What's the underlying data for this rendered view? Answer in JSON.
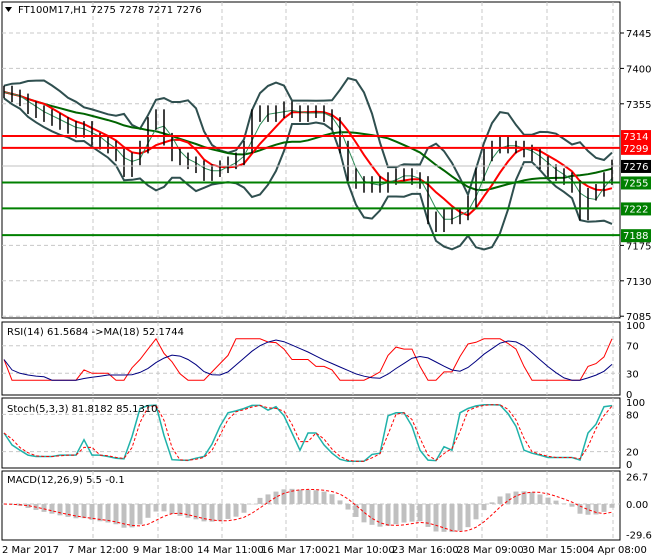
{
  "header": {
    "symbol": "FT100M17,H1",
    "ohlc": "7275 7278 7271 7276"
  },
  "colors": {
    "resistance": "#ff0000",
    "support": "#008000",
    "bid": "#000000",
    "band": "#2f4f4f",
    "ma_fast": "#ff0000",
    "ma_slow": "#006400",
    "rsi": "#ff0000",
    "rsi_ma": "#000080",
    "stoch_main": "#20b2aa",
    "stoch_signal": "#ff0000",
    "macd_hist": "#c0c0c0"
  },
  "chart_data": [
    {
      "type": "line",
      "title": "FT100M17,H1",
      "yticks": [
        "7445",
        "7400",
        "7355",
        "7175",
        "7130",
        "7085"
      ],
      "ylim": [
        7070,
        7487
      ],
      "levels": [
        {
          "value": "7314",
          "kind": "resistance"
        },
        {
          "value": "7299",
          "kind": "resistance"
        },
        {
          "value": "7255",
          "kind": "support"
        },
        {
          "value": "7222",
          "kind": "support"
        },
        {
          "value": "7188",
          "kind": "support"
        }
      ],
      "current_price": "7276",
      "closes": [
        7370,
        7365,
        7360,
        7350,
        7345,
        7340,
        7335,
        7330,
        7325,
        7320,
        7325,
        7310,
        7305,
        7300,
        7290,
        7270,
        7285,
        7300,
        7330,
        7340,
        7310,
        7290,
        7285,
        7280,
        7275,
        7265,
        7270,
        7275,
        7280,
        7285,
        7300,
        7340,
        7345,
        7340,
        7345,
        7350,
        7345,
        7340,
        7345,
        7345,
        7340,
        7330,
        7300,
        7265,
        7255,
        7250,
        7255,
        7250,
        7260,
        7265,
        7265,
        7260,
        7255,
        7210,
        7200,
        7215,
        7210,
        7215,
        7230,
        7265,
        7290,
        7300,
        7305,
        7300,
        7300,
        7295,
        7290,
        7280,
        7270,
        7265,
        7260,
        7250,
        7215,
        7240,
        7245,
        7260,
        7276
      ]
    },
    {
      "type": "line",
      "title": "RSI(14) 61.5684  ->MA(18) 52.1744",
      "yticks": [
        "100",
        "70",
        "30",
        "0"
      ],
      "ylim": [
        0,
        100
      ]
    },
    {
      "type": "line",
      "title": "Stoch(5,3,3) 81.8182 85.1310",
      "yticks": [
        "100",
        "80",
        "20",
        "0"
      ],
      "ylim": [
        0,
        100
      ]
    },
    {
      "type": "bar",
      "title": "MACD(12,26,9) 5.5 -0.1",
      "yticks": [
        "26.7",
        "0.00",
        "-29.6"
      ],
      "ylim": [
        -33,
        30
      ]
    }
  ],
  "xaxis": {
    "labels": [
      "2 Mar 2017",
      "7 Mar 12:00",
      "9 Mar 18:00",
      "14 Mar 11:00",
      "16 Mar 17:00",
      "21 Mar 10:00",
      "23 Mar 16:00",
      "28 Mar 09:00",
      "30 Mar 15:00",
      "4 Apr 08:00"
    ]
  }
}
